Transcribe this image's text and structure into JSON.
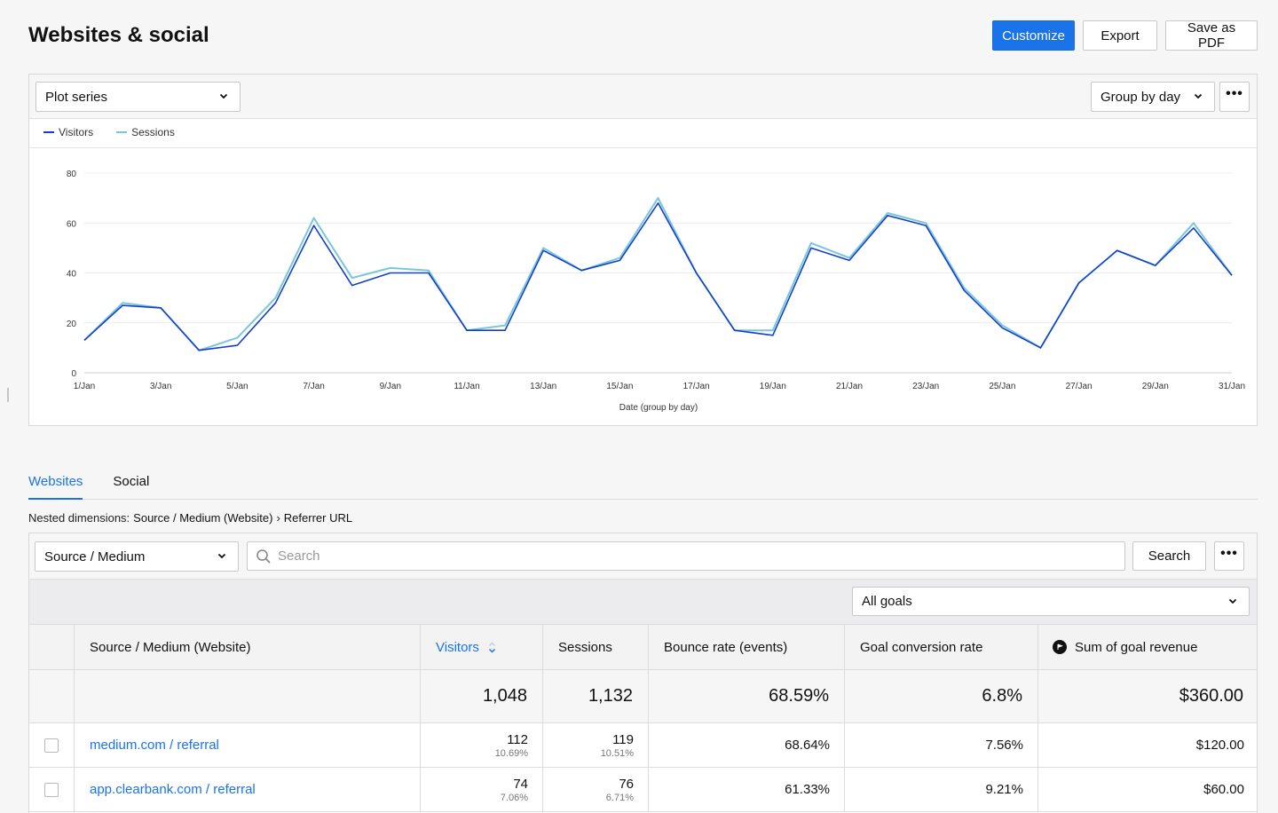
{
  "page": {
    "title": "Websites & social"
  },
  "actions": {
    "customize": "Customize",
    "export": "Export",
    "save_pdf": "Save as PDF"
  },
  "chart_toolbar": {
    "plot_series": "Plot series",
    "group_by": "Group by day",
    "more": "•••"
  },
  "colors": {
    "accent": "#1a73e8",
    "visitors": "#1440c8",
    "sessions": "#79c7d9"
  },
  "chart_data": {
    "type": "line",
    "x": [
      "1/Jan",
      "2/Jan",
      "3/Jan",
      "4/Jan",
      "5/Jan",
      "6/Jan",
      "7/Jan",
      "8/Jan",
      "9/Jan",
      "10/Jan",
      "11/Jan",
      "12/Jan",
      "13/Jan",
      "14/Jan",
      "15/Jan",
      "16/Jan",
      "17/Jan",
      "18/Jan",
      "19/Jan",
      "20/Jan",
      "21/Jan",
      "22/Jan",
      "23/Jan",
      "24/Jan",
      "25/Jan",
      "26/Jan",
      "27/Jan",
      "28/Jan",
      "29/Jan",
      "30/Jan",
      "31/Jan"
    ],
    "tick_labels": [
      "1/Jan",
      "3/Jan",
      "5/Jan",
      "7/Jan",
      "9/Jan",
      "11/Jan",
      "13/Jan",
      "15/Jan",
      "17/Jan",
      "19/Jan",
      "21/Jan",
      "23/Jan",
      "25/Jan",
      "27/Jan",
      "29/Jan",
      "31/Jan"
    ],
    "series": [
      {
        "name": "Visitors",
        "values": [
          13,
          27,
          26,
          9,
          11,
          28,
          59,
          35,
          40,
          40,
          17,
          17,
          49,
          41,
          45,
          68,
          40,
          17,
          15,
          50,
          45,
          63,
          59,
          33,
          18,
          10,
          36,
          49,
          43,
          58,
          39
        ]
      },
      {
        "name": "Sessions",
        "values": [
          13,
          28,
          26,
          9,
          14,
          30,
          62,
          38,
          42,
          41,
          17,
          19,
          50,
          41,
          46,
          70,
          40,
          17,
          17,
          52,
          46,
          64,
          60,
          34,
          19,
          10,
          36,
          49,
          43,
          60,
          39
        ]
      }
    ],
    "xlabel": "Date (group by day)",
    "ylabel": "",
    "ylim": [
      0,
      80
    ],
    "yticks": [
      "0",
      "20",
      "40",
      "60",
      "80"
    ],
    "grid": true,
    "legend": "top-left"
  },
  "tabs": [
    {
      "label": "Websites",
      "active": true
    },
    {
      "label": "Social",
      "active": false
    }
  ],
  "breadcrumb": {
    "prefix": "Nested dimensions:",
    "first": "Source / Medium (Website)",
    "sep": "›",
    "second": "Referrer URL"
  },
  "table_toolbar": {
    "dimension": "Source / Medium",
    "search_placeholder": "Search",
    "search_button": "Search",
    "more": "•••"
  },
  "goals": {
    "selected": "All goals"
  },
  "table": {
    "headers": [
      "Source / Medium (Website)",
      "Visitors",
      "Sessions",
      "Bounce rate (events)",
      "Goal conversion rate",
      "Sum of goal revenue"
    ],
    "totals": {
      "visitors": "1,048",
      "sessions": "1,132",
      "bounce": "68.59%",
      "conversion": "6.8%",
      "revenue": "$360.00"
    },
    "rows": [
      {
        "source": "medium.com / referral",
        "visitors": "112",
        "visitors_pct": "10.69%",
        "sessions": "119",
        "sessions_pct": "10.51%",
        "bounce": "68.64%",
        "conversion": "7.56%",
        "revenue": "$120.00"
      },
      {
        "source": "app.clearbank.com / referral",
        "visitors": "74",
        "visitors_pct": "7.06%",
        "sessions": "76",
        "sessions_pct": "6.71%",
        "bounce": "61.33%",
        "conversion": "9.21%",
        "revenue": "$60.00"
      }
    ]
  }
}
